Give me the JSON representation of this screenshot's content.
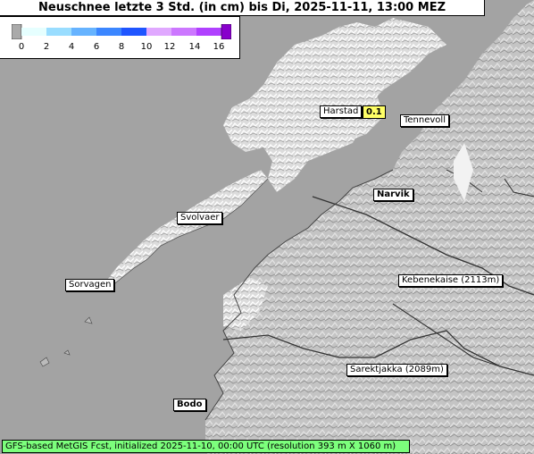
{
  "title": "Neuschnee letzte 3 Std. (in cm) bis Di, 2025-11-11, 13:00 MEZ",
  "legend": {
    "ticks": [
      "0",
      "2",
      "4",
      "6",
      "8",
      "10",
      "12",
      "14",
      "16"
    ],
    "colors": [
      "#e6ffff",
      "#99ddff",
      "#66b3ff",
      "#3b86ff",
      "#1f55ff",
      "#e0a8ff",
      "#cc77ff",
      "#b040ff",
      "#8800cc"
    ]
  },
  "places": [
    {
      "name": "Harstad"
    },
    {
      "name": "Tennevoll"
    },
    {
      "name": "Narvik"
    },
    {
      "name": "Svolvaer"
    },
    {
      "name": "Sorvagen"
    },
    {
      "name": "Kebenekaise (2113m)"
    },
    {
      "name": "Sarektjakka (2089m)"
    },
    {
      "name": "Bodo"
    }
  ],
  "value_badge": "0.1",
  "footer": "GFS-based MetGIS Fcst, initialized 2025-11-10, 00:00 UTC  (resolution 393 m X 1060 m)"
}
